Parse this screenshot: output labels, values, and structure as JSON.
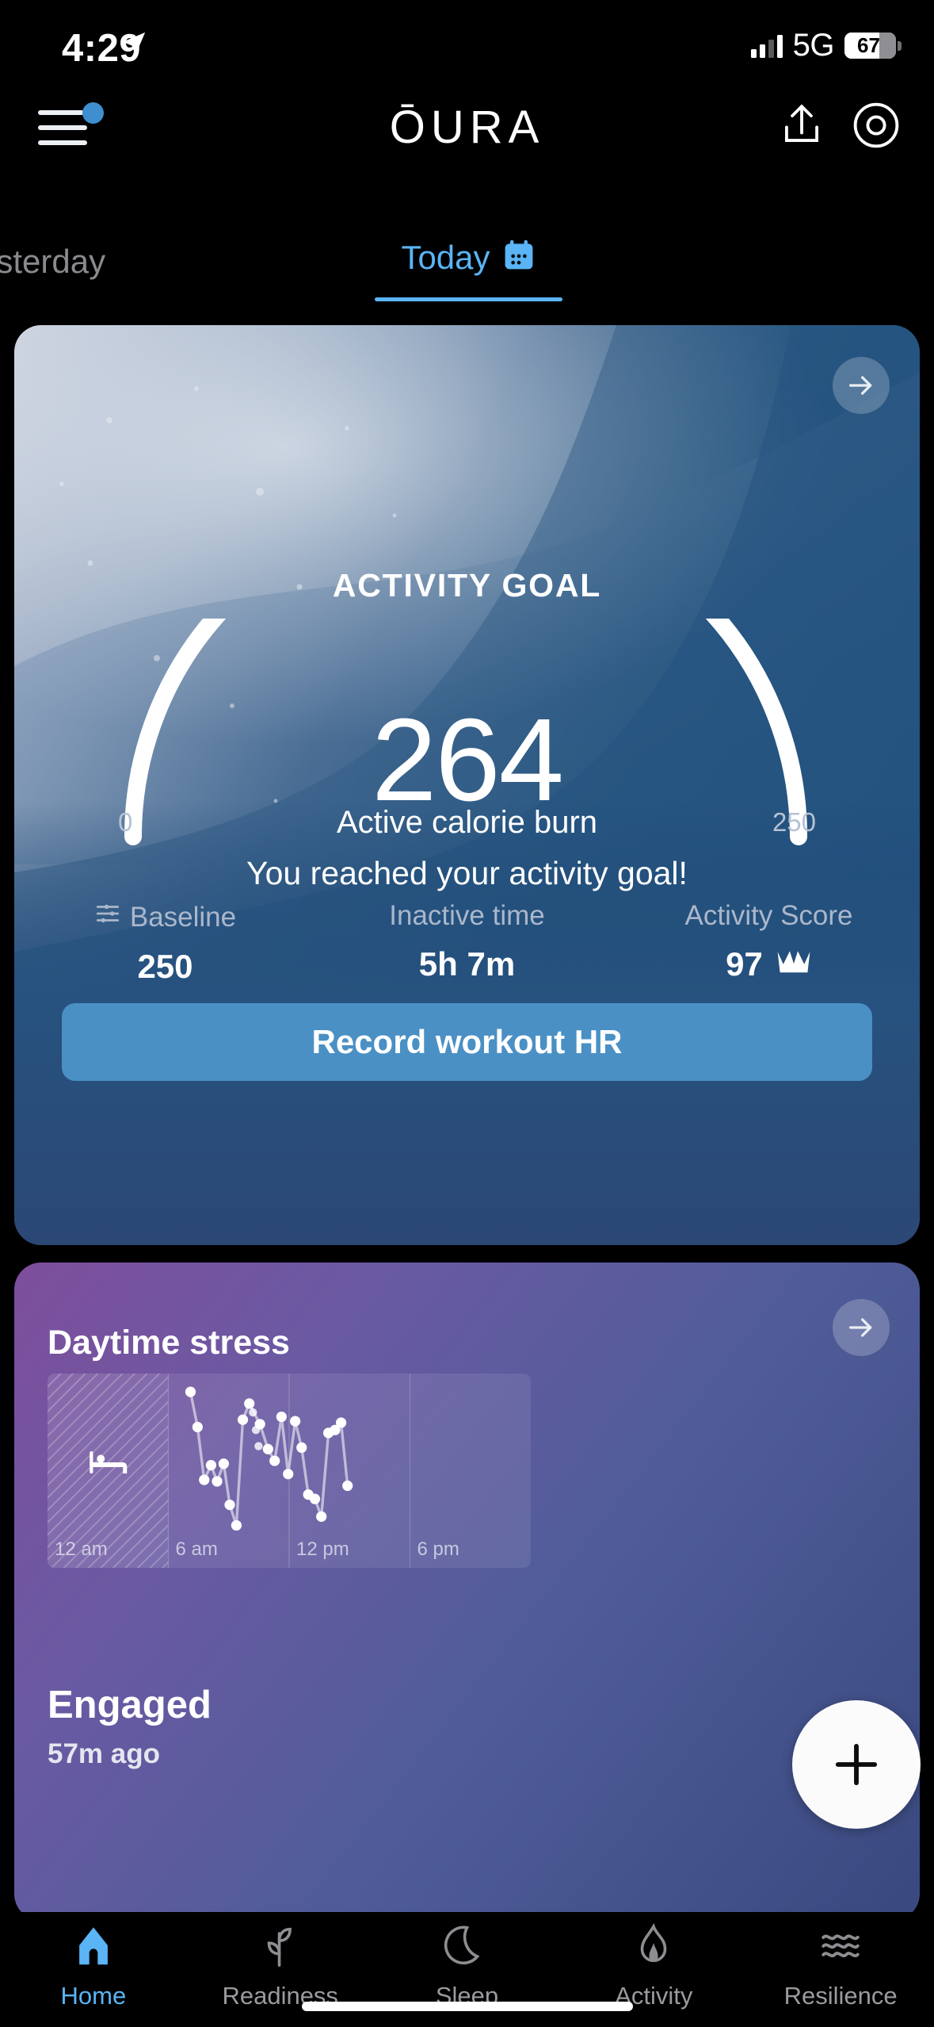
{
  "status_bar": {
    "time": "4:29",
    "location_icon": "location-arrow-icon",
    "network": "5G",
    "battery_percent": "67",
    "battery_level": 67
  },
  "header": {
    "menu_icon": "hamburger-menu-icon",
    "has_notification_dot": true,
    "brand": "ŌURA",
    "share_icon": "share-upload-icon",
    "ring_icon": "oura-ring-icon"
  },
  "day_tabs": {
    "yesterday_label": "esterday",
    "today_label": "Today",
    "calendar_icon": "calendar-icon",
    "active": "Today"
  },
  "activity_card": {
    "title": "ACTIVITY GOAL",
    "arrow_icon": "arrow-right-icon",
    "value": "264",
    "value_label": "Active calorie burn",
    "gauge_min": "0",
    "gauge_max": "250",
    "gauge_min_value": 0,
    "gauge_max_value": 250,
    "gauge_current_value": 264,
    "message": "You reached your activity goal!",
    "stats": [
      {
        "label": "Baseline",
        "value": "250",
        "icon": "sliders-icon",
        "badge": ""
      },
      {
        "label": "Inactive time",
        "value": "5h 7m",
        "icon": "",
        "badge": ""
      },
      {
        "label": "Activity Score",
        "value": "97",
        "icon": "",
        "badge": "crown-icon"
      }
    ],
    "button_label": "Record workout HR"
  },
  "stress_card": {
    "title": "Daytime stress",
    "arrow_icon": "arrow-right-icon",
    "sleep_icon": "bed-icon",
    "state": "Engaged",
    "timestamp": "57m ago"
  },
  "chart_data": {
    "type": "scatter",
    "title": "Daytime stress",
    "xlabel": "",
    "ylabel": "",
    "grid": true,
    "legend_position": "none",
    "x_tick_labels": [
      "12 am",
      "6 am",
      "12 pm",
      "6 pm"
    ],
    "x_tick_positions": [
      0,
      6,
      12,
      18
    ],
    "xlim": [
      0,
      24
    ],
    "ylim": [
      0,
      100
    ],
    "sleep_region": {
      "start": "12 am",
      "end": "6 am",
      "x_start": 0,
      "x_end": 6,
      "hatched": true
    },
    "points": [
      {
        "x": 7.1,
        "y": 94
      },
      {
        "x": 7.45,
        "y": 70
      },
      {
        "x": 7.78,
        "y": 34
      },
      {
        "x": 8.12,
        "y": 44
      },
      {
        "x": 8.42,
        "y": 33
      },
      {
        "x": 8.75,
        "y": 45
      },
      {
        "x": 9.05,
        "y": 17
      },
      {
        "x": 9.38,
        "y": 3
      },
      {
        "x": 9.7,
        "y": 75
      },
      {
        "x": 10.02,
        "y": 86
      },
      {
        "x": 10.55,
        "y": 72
      },
      {
        "x": 10.95,
        "y": 55
      },
      {
        "x": 11.28,
        "y": 47
      },
      {
        "x": 11.62,
        "y": 77
      },
      {
        "x": 11.95,
        "y": 38
      },
      {
        "x": 12.3,
        "y": 74
      },
      {
        "x": 12.62,
        "y": 56
      },
      {
        "x": 12.95,
        "y": 24
      },
      {
        "x": 13.28,
        "y": 21
      },
      {
        "x": 13.6,
        "y": 9
      },
      {
        "x": 13.95,
        "y": 66
      },
      {
        "x": 14.28,
        "y": 68
      },
      {
        "x": 14.58,
        "y": 73
      },
      {
        "x": 14.9,
        "y": 30
      }
    ],
    "dashed_points": [
      {
        "x": 10.2,
        "y": 80
      },
      {
        "x": 10.35,
        "y": 68
      },
      {
        "x": 10.48,
        "y": 57
      }
    ]
  },
  "fab": {
    "icon": "plus-icon"
  },
  "bottom_nav": {
    "active": "Home",
    "items": [
      {
        "label": "Home",
        "icon": "home-icon"
      },
      {
        "label": "Readiness",
        "icon": "plant-leaf-icon"
      },
      {
        "label": "Sleep",
        "icon": "moon-icon"
      },
      {
        "label": "Activity",
        "icon": "flame-icon"
      },
      {
        "label": "Resilience",
        "icon": "waves-icon"
      }
    ]
  },
  "colors": {
    "accent_blue": "#5ab4f5",
    "button_blue": "#4a90c4",
    "card_navy": "#2b4775",
    "background": "#000000"
  }
}
